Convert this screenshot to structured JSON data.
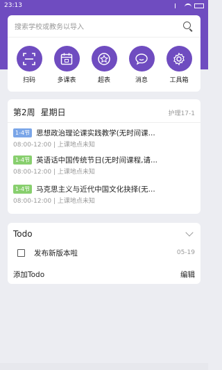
{
  "status_bar": {
    "time": "23:13"
  },
  "search": {
    "placeholder": "搜索学校或教务以导入"
  },
  "quick_actions": [
    {
      "label": "扫码",
      "icon": "scan-icon"
    },
    {
      "label": "多课表",
      "icon": "calendar-icon"
    },
    {
      "label": "超表",
      "icon": "star-icon"
    },
    {
      "label": "消息",
      "icon": "message-icon"
    },
    {
      "label": "工具箱",
      "icon": "gear-icon"
    }
  ],
  "schedule": {
    "week": "第2周",
    "weekday": "星期日",
    "class_name": "护理17-1",
    "courses": [
      {
        "badge": "1-4节",
        "name": "思想政治理论课实践教学(无时间课...",
        "time": "08:00-12:00",
        "location": "上课地点未知",
        "badge_color": "#7ba6e8"
      },
      {
        "badge": "1-4节",
        "name": "英语话中国传统节日(无时间课程,请...",
        "time": "08:00-12:00",
        "location": "上课地点未知",
        "badge_color": "#88cf6e"
      },
      {
        "badge": "1-4节",
        "name": "马克思主义与近代中国文化抉择(无...",
        "time": "08:00-12:00",
        "location": "上课地点未知",
        "badge_color": "#88cf6e"
      }
    ]
  },
  "todo": {
    "title": "Todo",
    "items": [
      {
        "text": "发布新版本啦",
        "date": "05-19"
      }
    ],
    "add_label": "添加Todo",
    "edit_label": "编辑"
  },
  "colors": {
    "accent": "#6f4cc0",
    "background": "#ecedf2"
  }
}
